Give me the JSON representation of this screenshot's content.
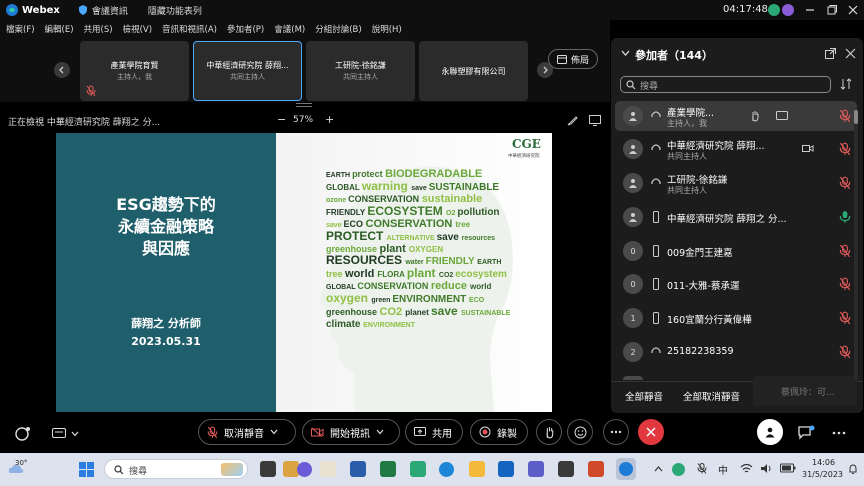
{
  "titlebar": {
    "app": "Webex",
    "meeting_info": "會議資訊",
    "hidden_tab": "隱藏功能表列",
    "time": "04:17:48"
  },
  "menu": [
    "檔案(F)",
    "編輯(E)",
    "共用(S)",
    "檢視(V)",
    "音訊和視訊(A)",
    "參加者(P)",
    "會議(M)",
    "分組討論(B)",
    "說明(H)"
  ],
  "thumbnails": [
    {
      "name": "產業學院育賢",
      "role": "主持人，我"
    },
    {
      "name": "中華經濟研究院 薛翔...",
      "role": "共同主持人"
    },
    {
      "name": "工研院-徐銘謙",
      "role": "共同主持人"
    },
    {
      "name": "永聯塑膠有限公司",
      "role": ""
    }
  ],
  "layout_label": "佈局",
  "viewing": {
    "text": "正在檢視 中華經濟研究院 薛翔之 分...",
    "zoom": "57%",
    "minus": "−",
    "plus": "+"
  },
  "slide": {
    "title_lines": [
      "ESG趨勢下的",
      "永續金融策略",
      "與因應"
    ],
    "presenter": "薛翔之 分析師",
    "date": "2023.05.31",
    "logo": "CGE",
    "logo_sub": "中華經濟研究院",
    "words": [
      "EARTH",
      "protect",
      "BIODEGRADABLE",
      "GLOBAL",
      "warning",
      "save",
      "SUSTAINABLE",
      "ozone",
      "CONSERVATION",
      "sustainable",
      "FRIENDLY",
      "ECOSYSTEM",
      "O2",
      "pollution",
      "save",
      "ECO",
      "CONSERVATION",
      "tree",
      "PROTECT",
      "ALTERNATIVE",
      "save",
      "resources",
      "greenhouse",
      "plant",
      "OXYGEN",
      "RESOURCES",
      "water",
      "FRIENDLY",
      "EARTH",
      "tree",
      "world",
      "FLORA",
      "plant",
      "CO2",
      "ecosystem",
      "GLOBAL",
      "CONSERVATION",
      "reduce",
      "world",
      "oxygen",
      "green",
      "ENVIRONMENT",
      "ECO",
      "greenhouse",
      "CO2",
      "planet",
      "save",
      "SUSTAINABLE",
      "climate",
      "ENVIRONMENT"
    ]
  },
  "panel": {
    "title": "參加者（144）",
    "search_placeholder": "搜尋",
    "participants": [
      {
        "avatar": "",
        "name": "產業學院...",
        "role": "主持人，我"
      },
      {
        "avatar": "",
        "name": "中華經濟研究院 薛翔...",
        "role": "共同主持人"
      },
      {
        "avatar": "",
        "name": "工研院-徐銘謙",
        "role": "共同主持人"
      },
      {
        "avatar": "",
        "name": "中華經濟研究院 薛翔之 分...",
        "role": ""
      },
      {
        "avatar": "0",
        "name": "009金門王建嘉",
        "role": ""
      },
      {
        "avatar": "0",
        "name": "011-大雅-蔡承運",
        "role": ""
      },
      {
        "avatar": "1",
        "name": "160宜蘭分行黃偉樺",
        "role": ""
      },
      {
        "avatar": "2",
        "name": "25182238359",
        "role": ""
      },
      {
        "avatar": "",
        "name": "",
        "role": ""
      }
    ],
    "mute_all": "全部靜音",
    "unmute_all": "全部取消靜音",
    "speaking": "蔡佩玲：可..."
  },
  "controls": {
    "unmute": "取消靜音",
    "start_video": "開始視訊",
    "share": "共用",
    "record": "錄製"
  },
  "taskbar": {
    "weather": "30°",
    "search": "搜尋",
    "ime": "中",
    "time": "14:06",
    "date": "31/5/2023"
  },
  "colors": {
    "accent": "#4aa8ff",
    "danger": "#e0383e",
    "slide_left": "#1f5f6b",
    "muted": "#e05a5a"
  }
}
